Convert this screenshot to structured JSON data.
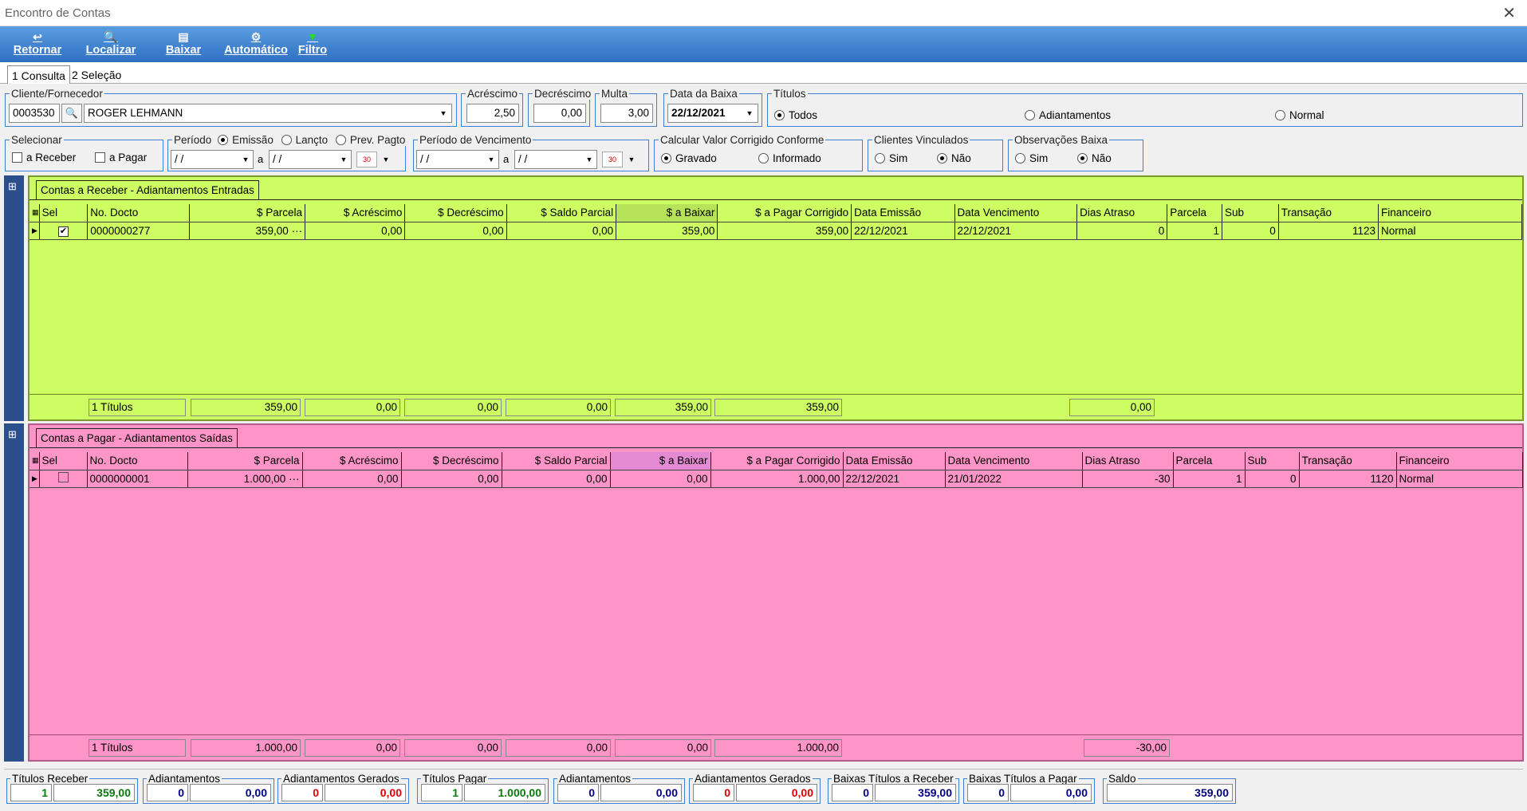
{
  "window": {
    "title": "Encontro de Contas",
    "close_glyph": "✕"
  },
  "toolbar": {
    "retornar": "Retornar",
    "localizar": "Localizar",
    "baixar": "Baixar",
    "automatico": "Automático",
    "filtro": "Filtro"
  },
  "tabs": [
    {
      "label": "1 Consulta"
    },
    {
      "label": "2 Seleção"
    }
  ],
  "filters": {
    "cliente_label": "Cliente/Fornecedor",
    "cliente_code": "0003530",
    "cliente_name": "ROGER LEHMANN",
    "acrescimo_label": "Acréscimo",
    "acrescimo": "2,50",
    "decrescimo_label": "Decréscimo",
    "decrescimo": "0,00",
    "multa_label": "Multa",
    "multa": "3,00",
    "data_baixa_label": "Data da Baixa",
    "data_baixa": "22/12/2021",
    "titulos_label": "Títulos",
    "titulos_options": [
      "Todos",
      "Adiantamentos",
      "Normal"
    ],
    "selecionar_label": "Selecionar",
    "sel_receber": "a Receber",
    "sel_pagar": "a Pagar",
    "periodo_label": "Período",
    "periodo_options": [
      "Emissão",
      "Lançto",
      "Prev. Pagto"
    ],
    "date_empty": "/ /",
    "a": "a",
    "venc_label": "Período de Vencimento",
    "calc_label": "Calcular Valor Corrigido Conforme",
    "calc_options": [
      "Gravado",
      "Informado"
    ],
    "vinc_label": "Clientes Vinculados",
    "obs_label": "Observações Baixa",
    "sim": "Sim",
    "nao": "Não"
  },
  "receber": {
    "caption": "Contas a Receber - Adiantamentos Entradas",
    "columns": [
      "Sel",
      "No. Docto",
      "$ Parcela",
      "$ Acréscimo",
      "$ Decréscimo",
      "$ Saldo Parcial",
      "$ a Baixar",
      "$ a Pagar Corrigido",
      "Data Emissão",
      "Data Vencimento",
      "Dias Atraso",
      "Parcela",
      "Sub",
      "Transação",
      "Financeiro"
    ],
    "rows": [
      {
        "sel": "✔",
        "docto": "0000000277",
        "parcela": "359,00",
        "more": "···",
        "acrescimo": "0,00",
        "decrescimo": "0,00",
        "saldo": "0,00",
        "baixar": "359,00",
        "corrigido": "359,00",
        "emissao": "22/12/2021",
        "vencimento": "22/12/2021",
        "atraso": "0",
        "parc": "1",
        "sub": "0",
        "transacao": "1123",
        "financeiro": "Normal"
      }
    ],
    "totals": {
      "titulos": "1 Títulos",
      "parcela": "359,00",
      "acrescimo": "0,00",
      "decrescimo": "0,00",
      "saldo": "0,00",
      "baixar": "359,00",
      "corrigido": "359,00",
      "atraso": "0,00"
    }
  },
  "pagar": {
    "caption": "Contas a Pagar - Adiantamentos Saídas",
    "columns": [
      "Sel",
      "No. Docto",
      "$ Parcela",
      "$ Acréscimo",
      "$ Decréscimo",
      "$ Saldo Parcial",
      "$ a Baixar",
      "$ a Pagar Corrigido",
      "Data Emissão",
      "Data Vencimento",
      "Dias Atraso",
      "Parcela",
      "Sub",
      "Transação",
      "Financeiro"
    ],
    "rows": [
      {
        "sel": "",
        "docto": "0000000001",
        "parcela": "1.000,00",
        "more": "···",
        "acrescimo": "0,00",
        "decrescimo": "0,00",
        "saldo": "0,00",
        "baixar": "0,00",
        "corrigido": "1.000,00",
        "emissao": "22/12/2021",
        "vencimento": "21/01/2022",
        "atraso": "-30",
        "parc": "1",
        "sub": "0",
        "transacao": "1120",
        "financeiro": "Normal"
      }
    ],
    "totals": {
      "titulos": "1 Títulos",
      "parcela": "1.000,00",
      "acrescimo": "0,00",
      "decrescimo": "0,00",
      "saldo": "0,00",
      "baixar": "0,00",
      "corrigido": "1.000,00",
      "atraso": "-30,00"
    }
  },
  "summary": {
    "titulos_receber": {
      "label": "Títulos Receber",
      "count": "1",
      "value": "359,00"
    },
    "adiant_r": {
      "label": "Adiantamentos",
      "count": "0",
      "value": "0,00"
    },
    "adiant_ger_r": {
      "label": "Adiantamentos Gerados",
      "count": "0",
      "value": "0,00"
    },
    "titulos_pagar": {
      "label": "Títulos Pagar",
      "count": "1",
      "value": "1.000,00"
    },
    "adiant_p": {
      "label": "Adiantamentos",
      "count": "0",
      "value": "0,00"
    },
    "adiant_ger_p": {
      "label": "Adiantamentos Gerados",
      "count": "0",
      "value": "0,00"
    },
    "baixas_receber": {
      "label": "Baixas Títulos a Receber",
      "count": "0",
      "value": "359,00"
    },
    "baixas_pagar": {
      "label": "Baixas Títulos a Pagar",
      "count": "0",
      "value": "0,00"
    },
    "saldo": {
      "label": "Saldo",
      "value": "359,00"
    }
  },
  "colors": {
    "receber_bg": "#cdfc63",
    "pagar_bg": "#ff94c8",
    "toolbar": "#3a7fd0",
    "green_text": "#0a7a0a",
    "red_text": "#e00000",
    "blue_text": "#000080"
  }
}
